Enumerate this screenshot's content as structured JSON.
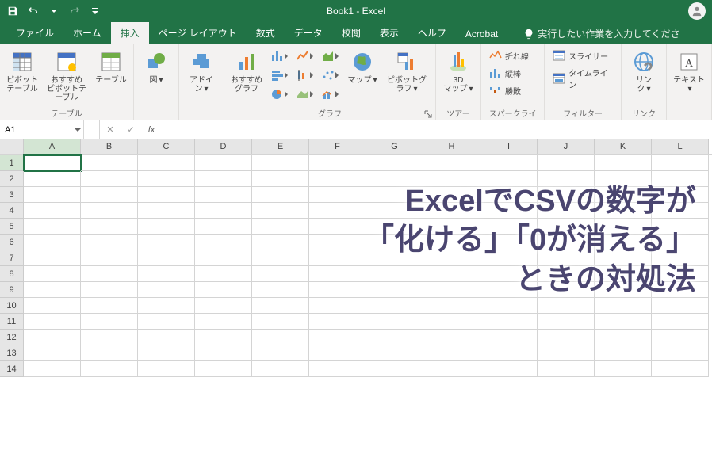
{
  "title": "Book1  -  Excel",
  "qat": {
    "save": "保存",
    "undo": "元に戻す",
    "redo": "やり直し",
    "custom": "カスタマイズ"
  },
  "tabs": [
    "ファイル",
    "ホーム",
    "挿入",
    "ページ レイアウト",
    "数式",
    "データ",
    "校閲",
    "表示",
    "ヘルプ",
    "Acrobat"
  ],
  "active_tab_index": 2,
  "tell_me": {
    "placeholder": "実行したい作業を入力してください"
  },
  "ribbon": {
    "tables": {
      "label": "テーブル",
      "pivot": "ピボット\nテーブル",
      "rec_pivot": "おすすめ\nピボットテーブル",
      "table": "テーブル"
    },
    "illus": {
      "label": "",
      "pic": "図"
    },
    "addins": {
      "label": "",
      "addin": "アドイ\nン"
    },
    "charts": {
      "label": "グラフ",
      "rec": "おすすめ\nグラフ",
      "map": "マップ",
      "pivotchart": "ピボットグラフ"
    },
    "tours": {
      "label": "ツアー",
      "map3d": "3D\nマップ"
    },
    "spark": {
      "label": "スパークライン",
      "line": "折れ線",
      "col": "縦棒",
      "winloss": "勝敗"
    },
    "filter": {
      "label": "フィルター",
      "slicer": "スライサー",
      "timeline": "タイムライン"
    },
    "link": {
      "label": "リンク",
      "link": "リン\nク"
    },
    "text": {
      "label": "",
      "text": "テキスト"
    }
  },
  "formula_bar": {
    "name": "A1",
    "fx": "fx"
  },
  "columns": [
    "A",
    "B",
    "C",
    "D",
    "E",
    "F",
    "G",
    "H",
    "I",
    "J",
    "K",
    "L"
  ],
  "rows": [
    1,
    2,
    3,
    4,
    5,
    6,
    7,
    8,
    9,
    10,
    11,
    12,
    13,
    14
  ],
  "active_col": 0,
  "active_row": 0,
  "overlay": {
    "l1": "ExcelでCSVの数字が",
    "l2": "「化ける」「0が消える」",
    "l3": "ときの対処法"
  }
}
